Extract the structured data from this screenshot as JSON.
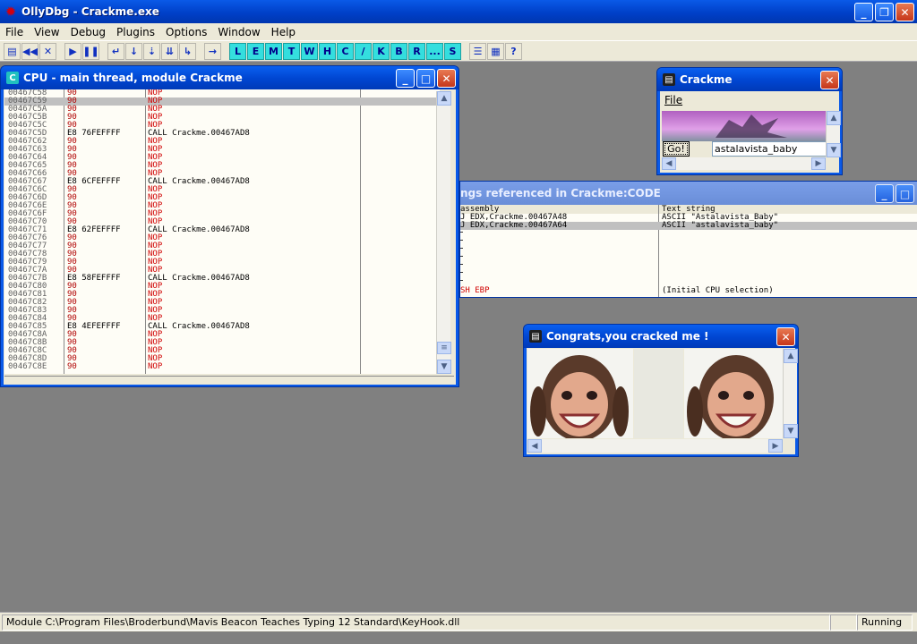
{
  "app": {
    "title": "OllyDbg - Crackme.exe",
    "icon": "bug-icon"
  },
  "menu": [
    "File",
    "View",
    "Debug",
    "Plugins",
    "Options",
    "Window",
    "Help"
  ],
  "toolbar": {
    "buttons": [
      {
        "name": "open-icon",
        "glyph": "▤"
      },
      {
        "name": "restart-icon",
        "glyph": "◀◀"
      },
      {
        "name": "close-program-icon",
        "glyph": "✕"
      },
      {
        "name": "run-icon",
        "glyph": "▶"
      },
      {
        "name": "pause-icon",
        "glyph": "❚❚"
      },
      {
        "name": "step-into-icon",
        "glyph": "↵"
      },
      {
        "name": "step-over-icon",
        "glyph": "↓"
      },
      {
        "name": "trace-into-icon",
        "glyph": "⇣"
      },
      {
        "name": "trace-over-icon",
        "glyph": "⇊"
      },
      {
        "name": "execute-till-return-icon",
        "glyph": "↳"
      },
      {
        "name": "goto-icon",
        "glyph": "→"
      }
    ],
    "letters": [
      "L",
      "E",
      "M",
      "T",
      "W",
      "H",
      "C",
      "/",
      "K",
      "B",
      "R",
      "...",
      "S"
    ],
    "extra": [
      {
        "name": "list-icon",
        "glyph": "☰"
      },
      {
        "name": "palette-icon",
        "glyph": "▦"
      },
      {
        "name": "help-icon",
        "glyph": "?"
      }
    ]
  },
  "cpu_window": {
    "title": "CPU - main thread, module Crackme",
    "icon_letter": "C",
    "rows": [
      {
        "addr": "00467C58",
        "hex": "90",
        "asm": "NOP"
      },
      {
        "addr": "00467C59",
        "hex": "90",
        "asm": "NOP",
        "selected": true
      },
      {
        "addr": "00467C5A",
        "hex": "90",
        "asm": "NOP"
      },
      {
        "addr": "00467C5B",
        "hex": "90",
        "asm": "NOP"
      },
      {
        "addr": "00467C5C",
        "hex": "90",
        "asm": "NOP"
      },
      {
        "addr": "00467C5D",
        "hex": "E8 76FEFFFF",
        "asm": "CALL Crackme.00467AD8",
        "call": true
      },
      {
        "addr": "00467C62",
        "hex": "90",
        "asm": "NOP"
      },
      {
        "addr": "00467C63",
        "hex": "90",
        "asm": "NOP"
      },
      {
        "addr": "00467C64",
        "hex": "90",
        "asm": "NOP"
      },
      {
        "addr": "00467C65",
        "hex": "90",
        "asm": "NOP"
      },
      {
        "addr": "00467C66",
        "hex": "90",
        "asm": "NOP"
      },
      {
        "addr": "00467C67",
        "hex": "E8 6CFEFFFF",
        "asm": "CALL Crackme.00467AD8",
        "call": true
      },
      {
        "addr": "00467C6C",
        "hex": "90",
        "asm": "NOP"
      },
      {
        "addr": "00467C6D",
        "hex": "90",
        "asm": "NOP"
      },
      {
        "addr": "00467C6E",
        "hex": "90",
        "asm": "NOP"
      },
      {
        "addr": "00467C6F",
        "hex": "90",
        "asm": "NOP"
      },
      {
        "addr": "00467C70",
        "hex": "90",
        "asm": "NOP"
      },
      {
        "addr": "00467C71",
        "hex": "E8 62FEFFFF",
        "asm": "CALL Crackme.00467AD8",
        "call": true
      },
      {
        "addr": "00467C76",
        "hex": "90",
        "asm": "NOP"
      },
      {
        "addr": "00467C77",
        "hex": "90",
        "asm": "NOP"
      },
      {
        "addr": "00467C78",
        "hex": "90",
        "asm": "NOP"
      },
      {
        "addr": "00467C79",
        "hex": "90",
        "asm": "NOP"
      },
      {
        "addr": "00467C7A",
        "hex": "90",
        "asm": "NOP"
      },
      {
        "addr": "00467C7B",
        "hex": "E8 58FEFFFF",
        "asm": "CALL Crackme.00467AD8",
        "call": true
      },
      {
        "addr": "00467C80",
        "hex": "90",
        "asm": "NOP"
      },
      {
        "addr": "00467C81",
        "hex": "90",
        "asm": "NOP"
      },
      {
        "addr": "00467C82",
        "hex": "90",
        "asm": "NOP"
      },
      {
        "addr": "00467C83",
        "hex": "90",
        "asm": "NOP"
      },
      {
        "addr": "00467C84",
        "hex": "90",
        "asm": "NOP"
      },
      {
        "addr": "00467C85",
        "hex": "E8 4EFEFFFF",
        "asm": "CALL Crackme.00467AD8",
        "call": true
      },
      {
        "addr": "00467C8A",
        "hex": "90",
        "asm": "NOP"
      },
      {
        "addr": "00467C8B",
        "hex": "90",
        "asm": "NOP"
      },
      {
        "addr": "00467C8C",
        "hex": "90",
        "asm": "NOP"
      },
      {
        "addr": "00467C8D",
        "hex": "90",
        "asm": "NOP"
      },
      {
        "addr": "00467C8E",
        "hex": "90",
        "asm": "NOP"
      }
    ]
  },
  "crackme_window": {
    "title": "Crackme",
    "menu_file": "File",
    "go_label": "Go!",
    "input_value": "astalavista_baby"
  },
  "strings_window": {
    "title": "ngs referenced in Crackme:CODE",
    "col_disasm": "assembly",
    "col_text": "Text string",
    "rows": [
      {
        "disasm": "J EDX,Crackme.00467A48",
        "text": "ASCII \"Astalavista_Baby\""
      },
      {
        "disasm": "J EDX,Crackme.00467A64",
        "text": "ASCII \"astalavista_baby\"",
        "selected": true
      }
    ],
    "last_row": {
      "disasm": "SH EBP",
      "text": "(Initial CPU selection)"
    }
  },
  "congrats_window": {
    "title": "Congrats,you cracked me !"
  },
  "status": {
    "message": "Module C:\\Program Files\\Broderbund\\Mavis Beacon Teaches Typing 12 Standard\\KeyHook.dll",
    "state": "Running"
  }
}
